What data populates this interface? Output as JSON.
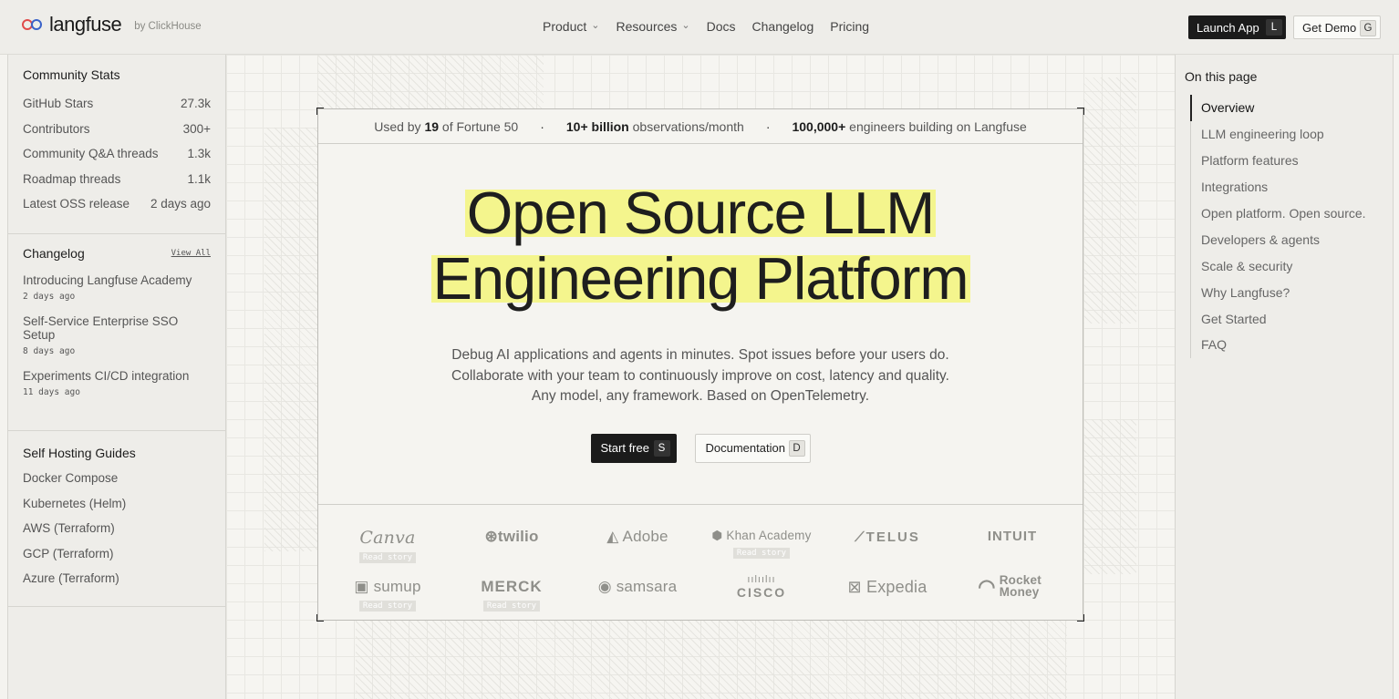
{
  "header": {
    "logo_text": "langfuse",
    "logo_by": "by ClickHouse",
    "nav": [
      "Product",
      "Resources",
      "Docs",
      "Changelog",
      "Pricing"
    ],
    "launch_label": "Launch App",
    "launch_key": "L",
    "demo_label": "Get Demo",
    "demo_key": "G"
  },
  "community": {
    "title": "Community Stats",
    "stats": [
      {
        "label": "GitHub Stars",
        "value": "27.3k"
      },
      {
        "label": "Contributors",
        "value": "300+"
      },
      {
        "label": "Community Q&A threads",
        "value": "1.3k"
      },
      {
        "label": "Roadmap threads",
        "value": "1.1k"
      },
      {
        "label": "Latest OSS release",
        "value": "2 days ago"
      }
    ]
  },
  "changelog": {
    "title": "Changelog",
    "view_all": "View All",
    "items": [
      {
        "title": "Introducing Langfuse Academy",
        "date": "2 days ago"
      },
      {
        "title": "Self-Service Enterprise SSO Setup",
        "date": "8 days ago"
      },
      {
        "title": "Experiments CI/CD integration",
        "date": "11 days ago"
      }
    ]
  },
  "guides": {
    "title": "Self Hosting Guides",
    "items": [
      "Docker Compose",
      "Kubernetes (Helm)",
      "AWS (Terraform)",
      "GCP (Terraform)",
      "Azure (Terraform)"
    ]
  },
  "toc": {
    "title": "On this page",
    "items": [
      "Overview",
      "LLM engineering loop",
      "Platform features",
      "Integrations",
      "Open platform. Open source.",
      "Developers & agents",
      "Scale & security",
      "Why Langfuse?",
      "Get Started",
      "FAQ"
    ],
    "active": "Overview"
  },
  "stats_bar": {
    "s1_pre": "Used by ",
    "s1_bold": "19",
    "s1_post": " of Fortune 50",
    "s2_bold": "10+ billion",
    "s2_post": " observations/month",
    "s3_bold": "100,000+",
    "s3_post": " engineers building on Langfuse",
    "separator": "·"
  },
  "hero": {
    "line1": "Open Source LLM",
    "line2": "Engineering Platform",
    "sub1": "Debug AI applications and agents in minutes. Spot issues before your users do.",
    "sub2": "Collaborate with your team to continuously improve on cost, latency and quality.",
    "sub3": "Any model, any framework. Based on OpenTelemetry.",
    "start_label": "Start free",
    "start_key": "S",
    "docs_label": "Documentation",
    "docs_key": "D"
  },
  "logos": {
    "story_label": "Read story",
    "items": [
      "Canva",
      "twilio",
      "Adobe",
      "Khan Academy",
      "TELUS",
      "INTUIT",
      "sumup",
      "MERCK",
      "samsara",
      "CISCO",
      "Expedia",
      "Rocket Money"
    ]
  },
  "colors": {
    "highlight": "#f4f58d",
    "dark_button": "#1b1b1b"
  }
}
